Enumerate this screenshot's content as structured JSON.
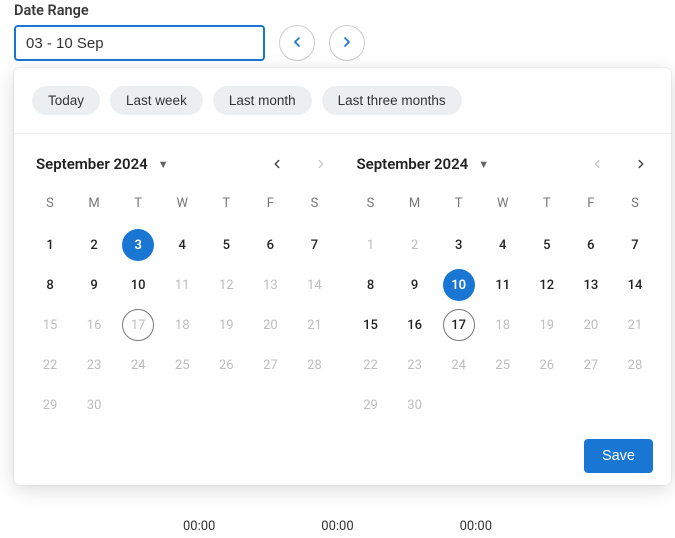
{
  "label": "Date Range",
  "input_value": "03 - 10 Sep",
  "presets": [
    "Today",
    "Last week",
    "Last month",
    "Last three months"
  ],
  "dow": [
    "S",
    "M",
    "T",
    "W",
    "T",
    "F",
    "S"
  ],
  "save_label": "Save",
  "bg_times": [
    "00:00",
    "00:00",
    "00:00"
  ],
  "calendars": [
    {
      "title": "September 2024",
      "prev_disabled": false,
      "next_disabled": true,
      "days": [
        {
          "n": 1,
          "in": true
        },
        {
          "n": 2,
          "in": true
        },
        {
          "n": 3,
          "in": true,
          "sel": true
        },
        {
          "n": 4,
          "in": true
        },
        {
          "n": 5,
          "in": true
        },
        {
          "n": 6,
          "in": true
        },
        {
          "n": 7,
          "in": true
        },
        {
          "n": 8,
          "in": true
        },
        {
          "n": 9,
          "in": true
        },
        {
          "n": 10,
          "in": true
        },
        {
          "n": 11,
          "in": false
        },
        {
          "n": 12,
          "in": false
        },
        {
          "n": 13,
          "in": false
        },
        {
          "n": 14,
          "in": false
        },
        {
          "n": 15,
          "in": false
        },
        {
          "n": 16,
          "in": false
        },
        {
          "n": 17,
          "in": false,
          "today": true
        },
        {
          "n": 18,
          "in": false
        },
        {
          "n": 19,
          "in": false
        },
        {
          "n": 20,
          "in": false
        },
        {
          "n": 21,
          "in": false
        },
        {
          "n": 22,
          "in": false
        },
        {
          "n": 23,
          "in": false
        },
        {
          "n": 24,
          "in": false
        },
        {
          "n": 25,
          "in": false
        },
        {
          "n": 26,
          "in": false
        },
        {
          "n": 27,
          "in": false
        },
        {
          "n": 28,
          "in": false
        },
        {
          "n": 29,
          "in": false
        },
        {
          "n": 30,
          "in": false
        }
      ]
    },
    {
      "title": "September 2024",
      "prev_disabled": true,
      "next_disabled": false,
      "days": [
        {
          "n": 1,
          "in": false
        },
        {
          "n": 2,
          "in": false
        },
        {
          "n": 3,
          "in": true
        },
        {
          "n": 4,
          "in": true
        },
        {
          "n": 5,
          "in": true
        },
        {
          "n": 6,
          "in": true
        },
        {
          "n": 7,
          "in": true
        },
        {
          "n": 8,
          "in": true
        },
        {
          "n": 9,
          "in": true
        },
        {
          "n": 10,
          "in": true,
          "sel": true
        },
        {
          "n": 11,
          "in": true
        },
        {
          "n": 12,
          "in": true
        },
        {
          "n": 13,
          "in": true
        },
        {
          "n": 14,
          "in": true
        },
        {
          "n": 15,
          "in": true
        },
        {
          "n": 16,
          "in": true
        },
        {
          "n": 17,
          "in": true,
          "today": true
        },
        {
          "n": 18,
          "in": false
        },
        {
          "n": 19,
          "in": false
        },
        {
          "n": 20,
          "in": false
        },
        {
          "n": 21,
          "in": false
        },
        {
          "n": 22,
          "in": false
        },
        {
          "n": 23,
          "in": false
        },
        {
          "n": 24,
          "in": false
        },
        {
          "n": 25,
          "in": false
        },
        {
          "n": 26,
          "in": false
        },
        {
          "n": 27,
          "in": false
        },
        {
          "n": 28,
          "in": false
        },
        {
          "n": 29,
          "in": false
        },
        {
          "n": 30,
          "in": false
        }
      ]
    }
  ]
}
